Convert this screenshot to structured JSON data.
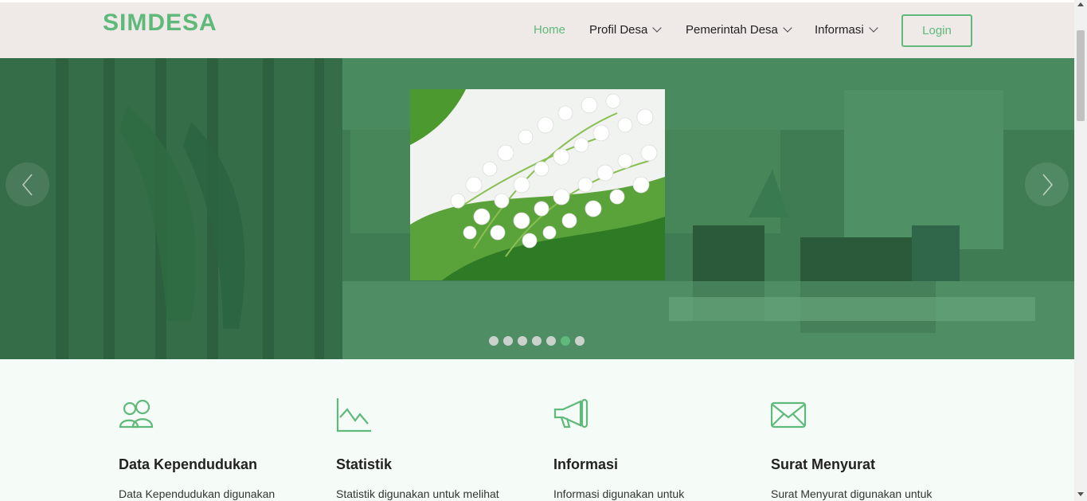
{
  "brand": "SIMDESA",
  "nav": {
    "home": "Home",
    "profil": "Profil Desa",
    "pemerintah": "Pemerintah Desa",
    "informasi": "Informasi",
    "login": "Login"
  },
  "carousel": {
    "slide_count": 7,
    "active_index": 5
  },
  "features": [
    {
      "icon": "people-icon",
      "title": "Data Kependudukan",
      "desc": "Data Kependudukan digunakan"
    },
    {
      "icon": "chart-line-icon",
      "title": "Statistik",
      "desc": "Statistik digunakan untuk melihat"
    },
    {
      "icon": "megaphone-icon",
      "title": "Informasi",
      "desc": "Informasi digunakan untuk"
    },
    {
      "icon": "envelope-icon",
      "title": "Surat Menyurat",
      "desc": "Surat Menyurat digunakan untuk"
    }
  ],
  "colors": {
    "accent": "#5fb97a",
    "hero_overlay": "#3d7a52",
    "navbar_bg": "#efe9e8"
  }
}
